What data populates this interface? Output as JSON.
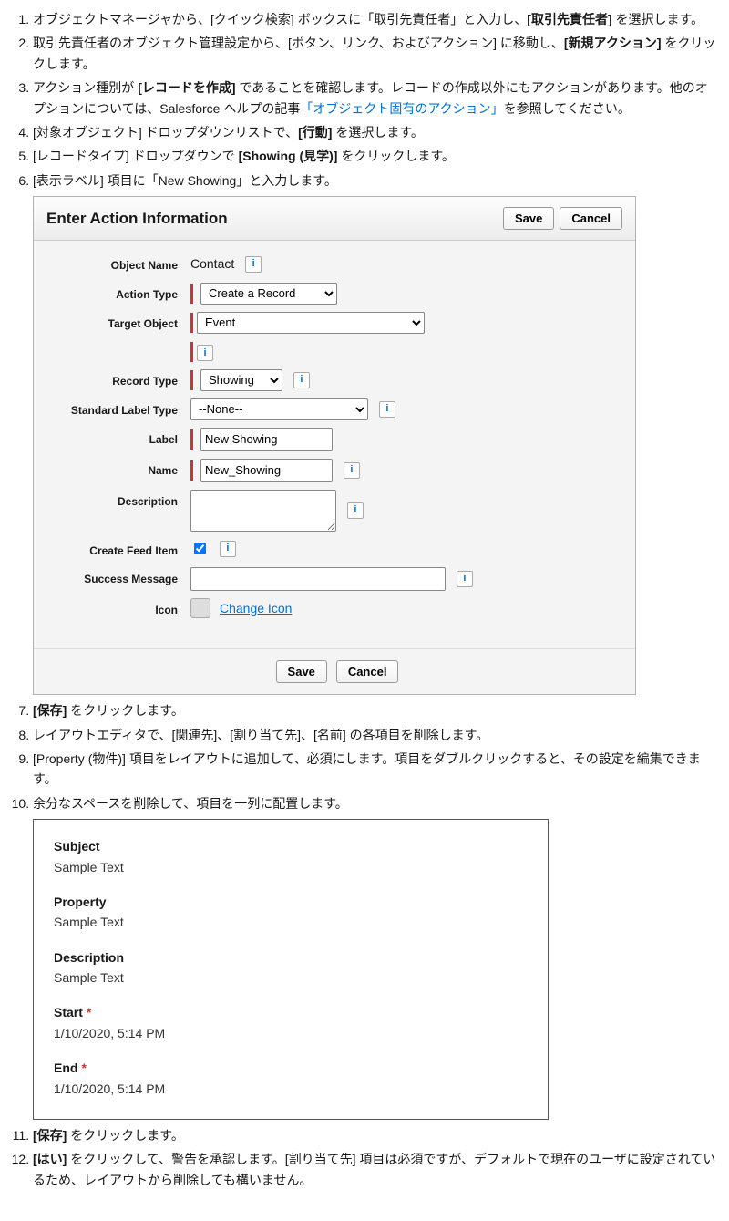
{
  "steps": {
    "s1a": "オブジェクトマネージャから、[クイック検索] ボックスに「取引先責任者」と入力し、",
    "s1b": "[取引先責任者]",
    "s1c": " を選択します。",
    "s2a": "取引先責任者のオブジェクト管理設定から、[ボタン、リンク、およびアクション] に移動し、",
    "s2b": "[新規アクション]",
    "s2c": " をクリックします。",
    "s3a": "アクション種別が ",
    "s3b": "[レコードを作成]",
    "s3c": " であることを確認します。レコードの作成以外にもアクションがあります。他のオプションについては、Salesforce ヘルプの記事",
    "s3link": "「オブジェクト固有のアクション」",
    "s3d": "を参照してください。",
    "s4a": "[対象オブジェクト] ドロップダウンリストで、",
    "s4b": "[行動]",
    "s4c": " を選択します。",
    "s5a": "[レコードタイプ] ドロップダウンで ",
    "s5b": "[Showing (見学)]",
    "s5c": " をクリックします。",
    "s6": "[表示ラベル] 項目に「New Showing」と入力します。",
    "s7a": "[保存]",
    "s7b": " をクリックします。",
    "s8": "レイアウトエディタで、[関連先]、[割り当て先]、[名前] の各項目を削除します。",
    "s9": "[Property (物件)] 項目をレイアウトに追加して、必須にします。項目をダブルクリックすると、その設定を編集できます。",
    "s10": "余分なスペースを削除して、項目を一列に配置します。",
    "s11a": "[保存]",
    "s11b": " をクリックします。",
    "s12a": "[はい]",
    "s12b": " をクリックして、警告を承認します。[割り当て先] 項目は必須ですが、デフォルトで現在のユーザに設定されているため、レイアウトから削除しても構いません。"
  },
  "dialog": {
    "title": "Enter Action Information",
    "save": "Save",
    "cancel": "Cancel",
    "labels": {
      "objectName": "Object Name",
      "actionType": "Action Type",
      "targetObject": "Target Object",
      "recordType": "Record Type",
      "stdLabelType": "Standard Label Type",
      "label": "Label",
      "name": "Name",
      "description": "Description",
      "createFeed": "Create Feed Item",
      "successMsg": "Success Message",
      "icon": "Icon"
    },
    "values": {
      "objectName": "Contact",
      "actionType": "Create a Record",
      "targetObject": "Event",
      "recordType": "Showing",
      "stdLabelType": "--None--",
      "label": "New Showing",
      "name": "New_Showing",
      "changeIcon": "Change Icon"
    }
  },
  "layout": {
    "subject": {
      "label": "Subject",
      "value": "Sample Text"
    },
    "property": {
      "label": "Property",
      "value": "Sample Text"
    },
    "description": {
      "label": "Description",
      "value": "Sample Text"
    },
    "start": {
      "label": "Start",
      "value": "1/10/2020, 5:14 PM"
    },
    "end": {
      "label": "End",
      "value": "1/10/2020, 5:14 PM"
    }
  }
}
